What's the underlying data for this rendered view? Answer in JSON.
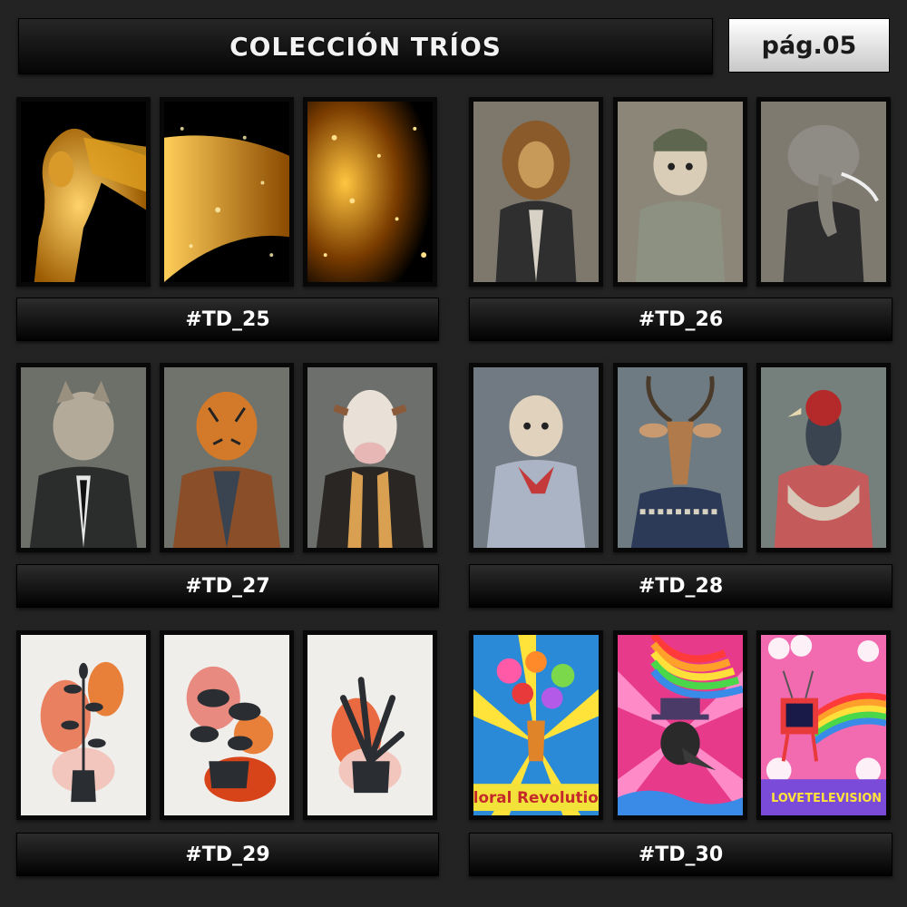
{
  "header": {
    "title": "COLECCIÓN TRÍOS",
    "page": "pág.05"
  },
  "items": [
    {
      "code": "#TD_25",
      "artworks": [
        "golden-woman-portrait",
        "golden-glitter-hair",
        "golden-glitter-particles"
      ]
    },
    {
      "code": "#TD_26",
      "artworks": [
        "lion-in-suit",
        "dog-in-hoodie",
        "elephant-in-suit"
      ]
    },
    {
      "code": "#TD_27",
      "artworks": [
        "wolf-in-suit",
        "tiger-in-coat",
        "cow-in-leather-jacket"
      ]
    },
    {
      "code": "#TD_28",
      "artworks": [
        "dog-with-scarf",
        "antelope-in-sweater",
        "bird-with-shawl"
      ]
    },
    {
      "code": "#TD_29",
      "artworks": [
        "plant-in-vase",
        "plant-in-pot",
        "leaf-plant-in-pot"
      ]
    },
    {
      "code": "#TD_30",
      "artworks": [
        "floral-revolution-poster",
        "plague-doctor-rainbow-poster",
        "love-television-poster"
      ]
    }
  ],
  "poster_texts": {
    "floral": "Floral Revolution",
    "love": "LOVE",
    "television": "TELEVISION"
  }
}
